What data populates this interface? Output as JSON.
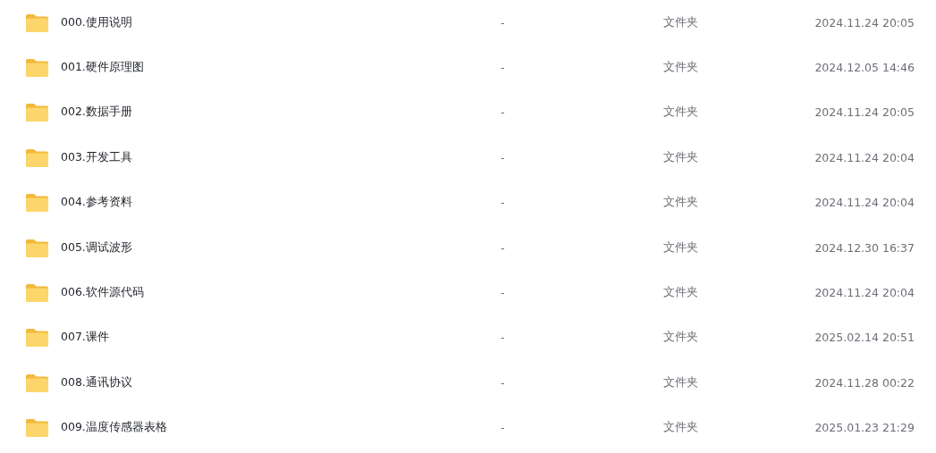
{
  "files": [
    {
      "name": "000.使用说明",
      "size": "-",
      "type": "文件夹",
      "modified": "2024.11.24 20:05"
    },
    {
      "name": "001.硬件原理图",
      "size": "-",
      "type": "文件夹",
      "modified": "2024.12.05 14:46"
    },
    {
      "name": "002.数据手册",
      "size": "-",
      "type": "文件夹",
      "modified": "2024.11.24 20:05"
    },
    {
      "name": "003.开发工具",
      "size": "-",
      "type": "文件夹",
      "modified": "2024.11.24 20:04"
    },
    {
      "name": "004.参考资料",
      "size": "-",
      "type": "文件夹",
      "modified": "2024.11.24 20:04"
    },
    {
      "name": "005.调试波形",
      "size": "-",
      "type": "文件夹",
      "modified": "2024.12.30 16:37"
    },
    {
      "name": "006.软件源代码",
      "size": "-",
      "type": "文件夹",
      "modified": "2024.11.24 20:04"
    },
    {
      "name": "007.课件",
      "size": "-",
      "type": "文件夹",
      "modified": "2025.02.14 20:51"
    },
    {
      "name": "008.通讯协议",
      "size": "-",
      "type": "文件夹",
      "modified": "2024.11.28 00:22"
    },
    {
      "name": "009.温度传感器表格",
      "size": "-",
      "type": "文件夹",
      "modified": "2025.01.23 21:29"
    }
  ]
}
